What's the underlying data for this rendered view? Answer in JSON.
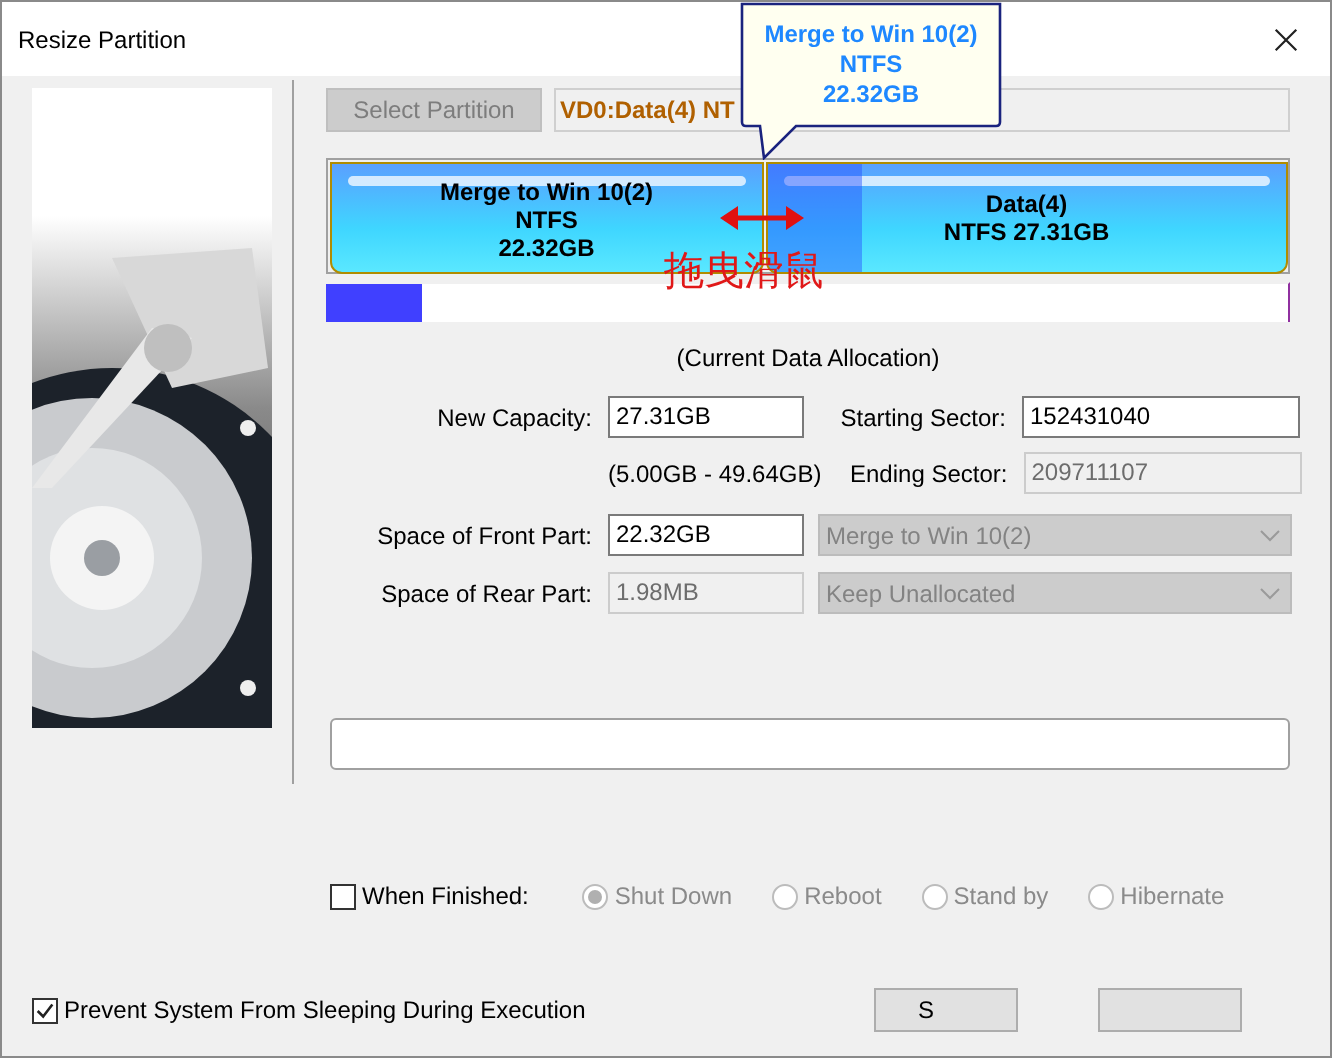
{
  "window": {
    "title": "Resize Partition"
  },
  "tooltip": {
    "lines": [
      "Merge to Win 10(2)",
      "NTFS",
      "22.32GB"
    ]
  },
  "select_button": {
    "label": "Select Partition",
    "disabled": true
  },
  "partition_field": {
    "value": "VD0:Data(4) NT"
  },
  "partitions": [
    {
      "lines": [
        "Merge to Win 10(2)",
        "NTFS",
        "22.32GB"
      ],
      "selected": false
    },
    {
      "lines": [
        "Data(4)",
        "NTFS 27.31GB"
      ],
      "selected": true
    }
  ],
  "annotation": {
    "text": "拖曳滑鼠"
  },
  "allocation_bar": {
    "level": 0.1
  },
  "caption": "(Current Data Allocation)",
  "new_capacity": {
    "label": "New Capacity:",
    "value": "27.31GB",
    "disabled": false
  },
  "range": "(5.00GB - 49.64GB)",
  "starting_sector": {
    "label": "Starting Sector:",
    "value": "152431040",
    "disabled": false
  },
  "ending_sector": {
    "label": "Ending Sector:",
    "value": "209711107",
    "disabled": true
  },
  "front_part": {
    "label": "Space of Front Part:",
    "value": "22.32GB",
    "disabled": false
  },
  "front_action": {
    "value": "Merge to Win 10(2)",
    "disabled": true
  },
  "rear_part": {
    "label": "Space of Rear Part:",
    "value": "1.98MB",
    "disabled": true
  },
  "rear_action": {
    "value": "Keep Unallocated",
    "disabled": true
  },
  "when_finished": {
    "label": "When Finished:",
    "checked": false
  },
  "finish_options": [
    {
      "label": "Shut Down",
      "selected": true,
      "disabled": true
    },
    {
      "label": "Reboot",
      "selected": false,
      "disabled": true
    },
    {
      "label": "Stand by",
      "selected": false,
      "disabled": true
    },
    {
      "label": "Hibernate",
      "selected": false,
      "disabled": true
    }
  ],
  "prevent_sleep": {
    "label": "Prevent System From Sleeping During Execution",
    "checked": true
  },
  "buttons": [
    {
      "kind": "text",
      "label": "S"
    },
    {
      "kind": "blank"
    }
  ]
}
